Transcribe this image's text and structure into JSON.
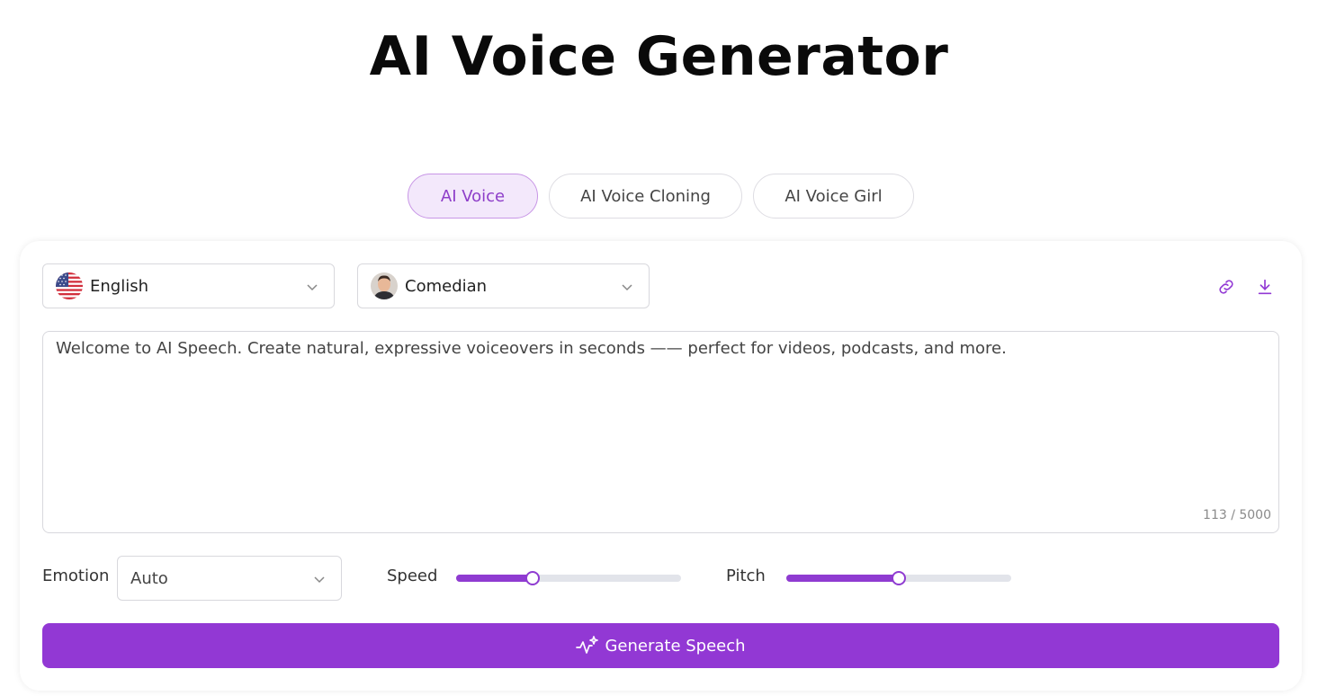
{
  "title": "AI Voice Generator",
  "tabs": [
    {
      "label": "AI Voice",
      "active": true
    },
    {
      "label": "AI Voice Cloning",
      "active": false
    },
    {
      "label": "AI Voice Girl",
      "active": false
    }
  ],
  "language": {
    "value": "English",
    "icon": "us-flag-icon"
  },
  "voice": {
    "value": "Comedian",
    "icon": "avatar-icon"
  },
  "actions": {
    "link_icon": "link-icon",
    "download_icon": "download-icon"
  },
  "text_input": {
    "value": "Welcome to AI Speech. Create natural, expressive voiceovers in seconds —— perfect for videos, podcasts, and more.",
    "counter": "113 / 5000"
  },
  "emotion": {
    "label": "Emotion",
    "value": "Auto"
  },
  "speed": {
    "label": "Speed",
    "level": 0.34
  },
  "pitch": {
    "label": "Pitch",
    "level": 0.5
  },
  "generate_button": {
    "label": "Generate Speech",
    "icon": "sparkle-wave-icon"
  },
  "colors": {
    "accent": "#9238d4",
    "tab_active_bg": "#f3e8fb",
    "tab_active_text": "#8e3ec9"
  }
}
